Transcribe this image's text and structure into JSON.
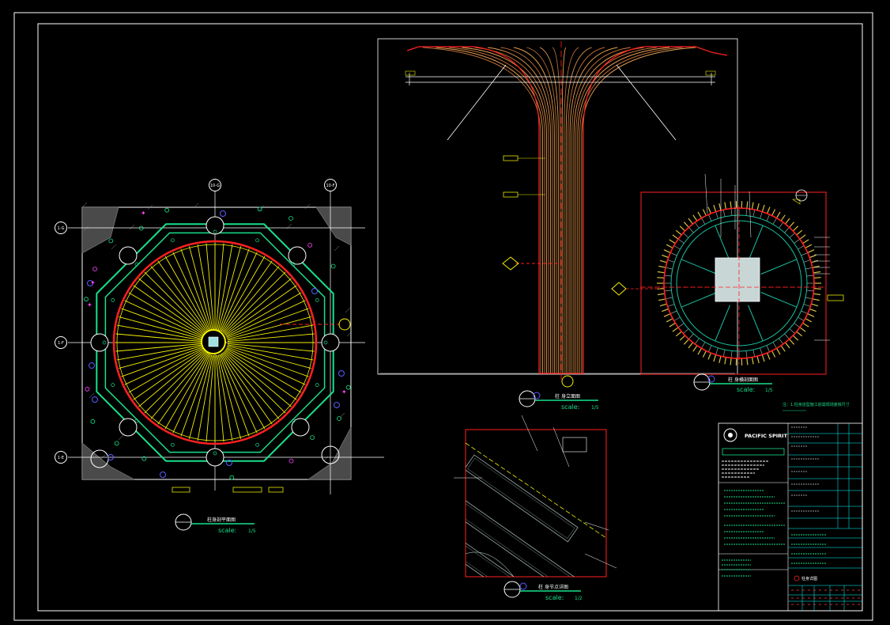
{
  "drawing": {
    "colors": {
      "background": "#000000",
      "frame": "#ffffff",
      "ring_red": "#ff2020",
      "rib_yellow": "#f5f000",
      "octagon_green": "#18e08a",
      "dim_cyan": "#00e0e0",
      "tag_yellow": "#e8e800",
      "hatch_gray": "#8a8a8a",
      "column_copper": "#d98a3a",
      "title_cyan": "#00ffff"
    },
    "plan": {
      "grid_tags": [
        "10-G",
        "10-F",
        "1-G",
        "1-F",
        "1-E"
      ],
      "caption_text": "柱身剖平面图",
      "scale_text": "scale:",
      "scale_value": "1/5"
    },
    "elevation": {
      "caption_text": "柱 身立面图",
      "scale_text": "scale:",
      "scale_value": "1/5"
    },
    "section": {
      "caption_text": "柱 身横剖面图",
      "scale_text": "scale:",
      "scale_value": "1/5"
    },
    "detail": {
      "caption_text": "柱 身节点详图",
      "scale_text": "scale:",
      "scale_value": "1/2"
    },
    "titleblock": {
      "company": "PACIFIC SPIRIT",
      "note_text": "注：1.柱身造型施工前需现场复核尺寸",
      "sheet_label": "柱身详图"
    }
  }
}
